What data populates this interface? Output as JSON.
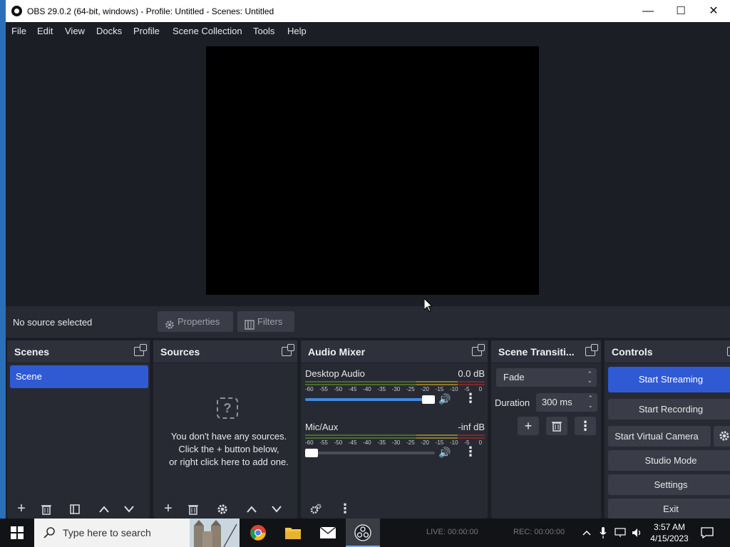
{
  "window": {
    "title": "OBS 29.0.2 (64-bit, windows) - Profile: Untitled - Scenes: Untitled",
    "minimize": "—",
    "maximize": "☐",
    "close": "✕"
  },
  "menu": [
    "File",
    "Edit",
    "View",
    "Docks",
    "Profile",
    "Scene Collection",
    "Tools",
    "Help"
  ],
  "context": {
    "no_source": "No source selected",
    "properties": "Properties",
    "filters": "Filters"
  },
  "scenes": {
    "title": "Scenes",
    "items": [
      "Scene"
    ]
  },
  "sources": {
    "title": "Sources",
    "empty_line1": "You don't have any sources.",
    "empty_line2": "Click the + button below,",
    "empty_line3": "or right click here to add one."
  },
  "mixer": {
    "title": "Audio Mixer",
    "ticks": [
      "-60",
      "-55",
      "-50",
      "-45",
      "-40",
      "-35",
      "-30",
      "-25",
      "-20",
      "-15",
      "-10",
      "-5",
      "0"
    ],
    "channels": [
      {
        "name": "Desktop Audio",
        "db": "0.0 dB",
        "volume": 1.0
      },
      {
        "name": "Mic/Aux",
        "db": "-inf dB",
        "volume": 0.0
      }
    ]
  },
  "transitions": {
    "title": "Scene Transiti...",
    "selected": "Fade",
    "duration_label": "Duration",
    "duration_value": "300 ms"
  },
  "controls": {
    "title": "Controls",
    "start_streaming": "Start Streaming",
    "start_recording": "Start Recording",
    "start_virtual_camera": "Start Virtual Camera",
    "studio_mode": "Studio Mode",
    "settings": "Settings",
    "exit": "Exit"
  },
  "taskbar": {
    "search_placeholder": "Type here to search",
    "live": "LIVE: 00:00:00",
    "rec": "REC: 00:00:00",
    "time": "3:57 AM",
    "date": "4/15/2023"
  },
  "colors": {
    "accent": "#2f5ad4",
    "background": "#1c1e26",
    "panel": "#272a33"
  }
}
